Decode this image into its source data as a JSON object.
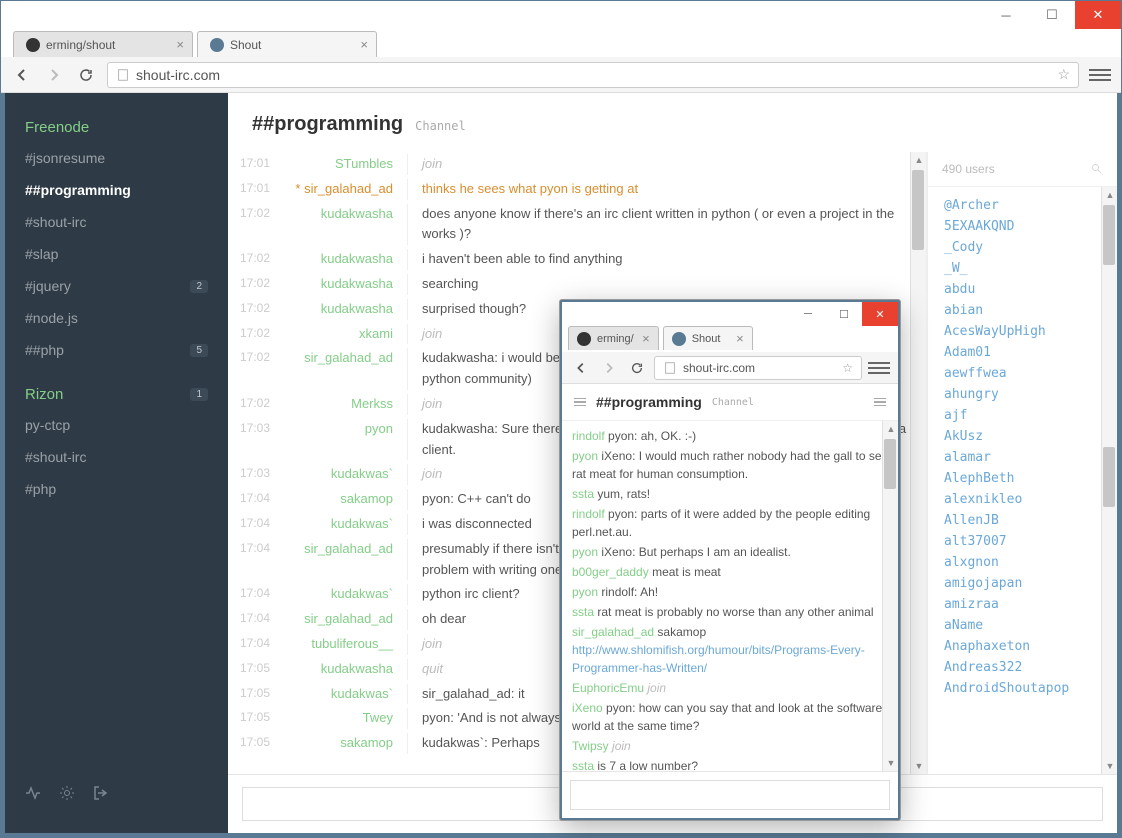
{
  "window": {
    "tabs": [
      {
        "title": "erming/shout",
        "favicon": "github"
      },
      {
        "title": "Shout",
        "favicon": "shout"
      }
    ],
    "active_tab": 1,
    "url": "shout-irc.com"
  },
  "sidebar": {
    "networks": [
      {
        "name": "Freenode",
        "channels": [
          {
            "name": "#jsonresume",
            "badge": null,
            "active": false
          },
          {
            "name": "##programming",
            "badge": null,
            "active": true
          },
          {
            "name": "#shout-irc",
            "badge": null,
            "active": false
          },
          {
            "name": "#slap",
            "badge": null,
            "active": false
          },
          {
            "name": "#jquery",
            "badge": "2",
            "active": false
          },
          {
            "name": "#node.js",
            "badge": null,
            "active": false
          },
          {
            "name": "##php",
            "badge": "5",
            "active": false
          }
        ]
      },
      {
        "name": "Rizon",
        "badge": "1",
        "channels": [
          {
            "name": "py-ctcp",
            "badge": null,
            "active": false
          },
          {
            "name": "#shout-irc",
            "badge": null,
            "active": false
          },
          {
            "name": "#php",
            "badge": null,
            "active": false
          }
        ]
      }
    ]
  },
  "channel": {
    "title": "##programming",
    "type": "Channel"
  },
  "messages": [
    {
      "time": "17:01",
      "nick": "STumbles",
      "text": "join",
      "kind": "event"
    },
    {
      "time": "17:01",
      "nick": "* sir_galahad_ad",
      "text": "thinks he sees what pyon is getting at",
      "kind": "action"
    },
    {
      "time": "17:02",
      "nick": "kudakwasha",
      "text": "does anyone know if there's an irc client written in python ( or even a project in the works )?",
      "kind": "msg"
    },
    {
      "time": "17:02",
      "nick": "kudakwasha",
      "text": "i haven't been able to find anything",
      "kind": "msg"
    },
    {
      "time": "17:02",
      "nick": "kudakwasha",
      "text": "searching",
      "kind": "msg"
    },
    {
      "time": "17:02",
      "nick": "kudakwasha",
      "text": "surprised though?",
      "kind": "msg"
    },
    {
      "time": "17:02",
      "nick": "xkami",
      "text": "join",
      "kind": "event"
    },
    {
      "time": "17:02",
      "nick": "sir_galahad_ad",
      "text": "kudakwasha: i would be surprised if there wasn't one (i don't know much about python community)",
      "kind": "msg"
    },
    {
      "time": "17:02",
      "nick": "Merkss",
      "text": "join",
      "kind": "event"
    },
    {
      "time": "17:03",
      "nick": "pyon",
      "text": "kudakwasha: Sure there is. But that is a special case. In general, an IRC bot is not a client.",
      "kind": "msg"
    },
    {
      "time": "17:03",
      "nick": "kudakwas`",
      "text": "join",
      "kind": "event"
    },
    {
      "time": "17:04",
      "nick": "sakamop",
      "text": "pyon: C++ can't do",
      "kind": "msg"
    },
    {
      "time": "17:04",
      "nick": "kudakwas`",
      "text": "i was disconnected",
      "kind": "msg"
    },
    {
      "time": "17:04",
      "nick": "sir_galahad_ad",
      "text": "presumably if there isn't one that could be a sign that for some reason there's a problem with writing one in python that makes it not worth as such relatively",
      "kind": "msg"
    },
    {
      "time": "17:04",
      "nick": "kudakwas`",
      "text": "python irc client?",
      "kind": "msg"
    },
    {
      "time": "17:04",
      "nick": "sir_galahad_ad",
      "text": "oh dear",
      "kind": "msg"
    },
    {
      "time": "17:04",
      "nick": "tubuliferous__",
      "text": "join",
      "kind": "event"
    },
    {
      "time": "17:05",
      "nick": "kudakwasha",
      "text": "quit",
      "kind": "event"
    },
    {
      "time": "17:05",
      "nick": "kudakwas`",
      "text": "sir_galahad_ad: it",
      "kind": "msg"
    },
    {
      "time": "17:05",
      "nick": "Twey",
      "text": "pyon: 'And is not always the case (e.g. the Lisps I use) and can be rather picky?",
      "kind": "msg"
    },
    {
      "time": "17:05",
      "nick": "sakamop",
      "text": "kudakwas`: Perhaps",
      "kind": "msg"
    }
  ],
  "users": {
    "count": "490 users",
    "list": [
      "@Archer",
      "5EXAAKQND",
      "_Cody",
      "_W_",
      "abdu",
      "abian",
      "AcesWayUpHigh",
      "Adam01",
      "aewffwea",
      "ahungry",
      "ajf",
      "AkUsz",
      "alamar",
      "AlephBeth",
      "alexnikleo",
      "AllenJB",
      "alt37007",
      "alxgnon",
      "amigojapan",
      "amizraa",
      "aName",
      "Anaphaxeton",
      "Andreas322",
      "AndroidShoutapop"
    ]
  },
  "small_window": {
    "tabs": [
      {
        "title": "erming/",
        "favicon": "github"
      },
      {
        "title": "Shout",
        "favicon": "shout"
      }
    ],
    "url": "shout-irc.com",
    "channel_title": "##programming",
    "channel_type": "Channel",
    "messages": [
      {
        "nick": "rindolf",
        "text": "pyon: ah, OK. :-)"
      },
      {
        "nick": "pyon",
        "text": "iXeno: I would much rather nobody had the gall to sell rat meat for human consumption."
      },
      {
        "nick": "ssta",
        "text": "yum, rats!"
      },
      {
        "nick": "rindolf",
        "text": "pyon: parts of it were added by the people editing perl.net.au."
      },
      {
        "nick": "pyon",
        "text": "iXeno: But perhaps I am an idealist."
      },
      {
        "nick": "b00ger_daddy",
        "text": "meat is meat"
      },
      {
        "nick": "pyon",
        "text": "rindolf: Ah!"
      },
      {
        "nick": "ssta",
        "text": "rat meat is probably no worse than any other animal"
      },
      {
        "nick": "sir_galahad_ad",
        "text": "sakamop",
        "link": "http://www.shlomifish.org/humour/bits/Programs-Every-Programmer-has-Written/"
      },
      {
        "nick": "EuphoricEmu",
        "text": "join",
        "kind": "event"
      },
      {
        "nick": "iXeno",
        "text": "pyon: how can you say that and look at the software world at the same time?"
      },
      {
        "nick": "Twipsy",
        "text": "join",
        "kind": "event"
      },
      {
        "nick": "ssta",
        "text": "is 7 a low number?"
      }
    ]
  }
}
